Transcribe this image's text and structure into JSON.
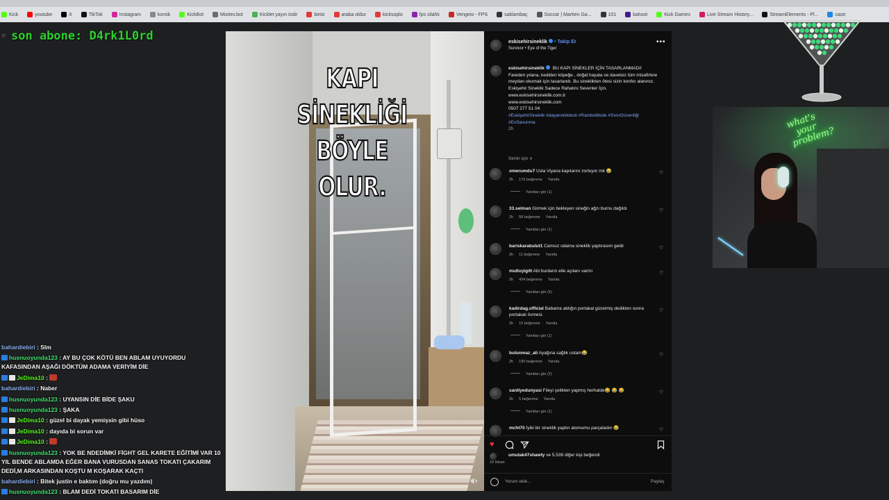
{
  "bookmarks": [
    {
      "label": "Kick",
      "color": "#53fc18"
    },
    {
      "label": "youtube",
      "color": "#ff0000"
    },
    {
      "label": "X",
      "color": "#000000"
    },
    {
      "label": "TikTok",
      "color": "#111111"
    },
    {
      "label": "Instagram",
      "color": "#d6249f"
    },
    {
      "label": "komik",
      "color": "#888888"
    },
    {
      "label": "KickBot",
      "color": "#53fc18"
    },
    {
      "label": "Mixitev.bot",
      "color": "#6b6b6b"
    },
    {
      "label": "Kicklet yayın indir",
      "color": "#4caf50"
    },
    {
      "label": "binto",
      "color": "#e53935"
    },
    {
      "label": "araba oldur",
      "color": "#e53935"
    },
    {
      "label": "kicksoplo",
      "color": "#e53935"
    },
    {
      "label": "fps silahlı",
      "color": "#8e24aa"
    },
    {
      "label": "Vengeio - FPS",
      "color": "#c62828"
    },
    {
      "label": "saklambaç",
      "color": "#333333"
    },
    {
      "label": "Soccar | Martien Ga...",
      "color": "#555555"
    },
    {
      "label": "101",
      "color": "#333333"
    },
    {
      "label": "kahoot",
      "color": "#46178f"
    },
    {
      "label": "Kick Games",
      "color": "#53fc18"
    },
    {
      "label": "Live Stream History...",
      "color": "#d81b60"
    },
    {
      "label": "StreamElements - Pl...",
      "color": "#111111"
    },
    {
      "label": "castr",
      "color": "#1e88e5"
    }
  ],
  "overlay": {
    "last_sub": "son abone: D4rk1L0rd"
  },
  "chat": [
    {
      "user": "bahardiebiri",
      "color": "#8aaef0",
      "badges": [],
      "text": ": Slm",
      "emote": false
    },
    {
      "user": "husnuoyunda123",
      "color": "#3fe06d",
      "badges": [
        "#2a7de1"
      ],
      "text": ": AY BU ÇOK KÖTÜ BEN ABLAM UYUYORDU KAFASINDAN AŞAĞI DÖKTÜM ADAMA VERİYİM DİE",
      "emote": false
    },
    {
      "user": "JeDima10",
      "color": "#53fc18",
      "badges": [
        "#2a7de1",
        "#e6e6e6"
      ],
      "text": ":",
      "emote": true
    },
    {
      "user": "bahardiebiri",
      "color": "#8aaef0",
      "badges": [],
      "text": ": Naber",
      "emote": false
    },
    {
      "user": "husnuoyunda123",
      "color": "#3fe06d",
      "badges": [
        "#2a7de1"
      ],
      "text": ": UYANSIN DİE BİDE ŞAKU",
      "emote": false
    },
    {
      "user": "husnuoyunda123",
      "color": "#3fe06d",
      "badges": [
        "#2a7de1"
      ],
      "text": ": ŞAKA",
      "emote": false
    },
    {
      "user": "JeDima10",
      "color": "#53fc18",
      "badges": [
        "#2a7de1",
        "#e6e6e6"
      ],
      "text": ": güzel bi dayak yemişsin gibi hüso",
      "emote": false
    },
    {
      "user": "JeDima10",
      "color": "#53fc18",
      "badges": [
        "#2a7de1",
        "#e6e6e6"
      ],
      "text": ": dayıda bi sorun var",
      "emote": false
    },
    {
      "user": "JeDima10",
      "color": "#53fc18",
      "badges": [
        "#2a7de1",
        "#e6e6e6"
      ],
      "text": ":",
      "emote": true
    },
    {
      "user": "husnuoyunda123",
      "color": "#3fe06d",
      "badges": [
        "#2a7de1"
      ],
      "text": ": YOK BE NDEDİMKİ FİGHT GEL KARETE EĞİTİMİ VAR 10 YIL BENDE ABLAMDA EĞER BANA VURUSDAN SANAS TOKATI ÇAKARIM DEDİ,M ARKASINDAN KOŞTU M KOŞARAK KAÇTI",
      "emote": false
    },
    {
      "user": "bahardiebiri",
      "color": "#8aaef0",
      "badges": [],
      "text": ": Bitek justin e baktım (doğru mu yazdım)",
      "emote": false
    },
    {
      "user": "husnuoyunda123",
      "color": "#3fe06d",
      "badges": [
        "#2a7de1"
      ],
      "text": ": BLAM DEDİ TOKATI BASARIM DİE",
      "emote": false
    }
  ],
  "video": {
    "overlay_line1": "KAPI SİNEKLİĞİ",
    "overlay_line2": "BÖYLE OLUR."
  },
  "post": {
    "username": "eskisehirsineklik",
    "follow_label": "• Takip Et",
    "audio": "Survivor • Eye of the Tiger",
    "more_icon": "more-horizontal-icon",
    "caption_user": "eskisehirsineklik",
    "caption_lines": [
      "BU KAPI SİNEKLER İÇİN TASARLANMADI!",
      "Fareden yılana, kediden köpeğe , doğal hayata ve davetsiz tüm misafirlere meydan okumak için tasarlandı. Bu sineklikten ötesi sizin konfor alanınız.",
      "Eskişehir Sineklik Sadece Rahatını Sevenler İçin.",
      "www.eskisehirsineklik.com.tr",
      "www.eskisehirsineklik.com",
      "0507 277 51 04"
    ],
    "hashtags": "#EskişehirSineklik #dayanıklıktesti #RamboMode #SınırGüvenliği #EvSavunma",
    "caption_time": "2h",
    "for_you": "Senin için ∨",
    "comments": [
      {
        "user": "omerumdu7",
        "text": "Usta Viyana kapılarını zorluyor mk 😂",
        "time": "2h",
        "likes": "179 beğenme",
        "reply": "Yanıtla",
        "replies": "Yanıtları gör (1)"
      },
      {
        "user": "33.selman",
        "text": "Girmek için bekleyen sineğin ağzı burnu dağıldı",
        "time": "2h",
        "likes": "58 beğenme",
        "reply": "Yanıtla",
        "replies": "Yanıtları gör (1)"
      },
      {
        "user": "bariskarabulut1",
        "text": "Camsız odama sineklik yaptırasım geldi",
        "time": "2h",
        "likes": "11 beğenme",
        "reply": "Yanıtla",
        "replies": ""
      },
      {
        "user": "mutluyigitt",
        "text": "Abi bunların elle açılanı varmı",
        "time": "2h",
        "likes": "434 beğenme",
        "reply": "Yanıtla",
        "replies": "Yanıtları gör (5)"
      },
      {
        "user": "kadirdag.official",
        "text": "Babama aldığın portakal güzelmiş dedikten sonra portakalı övmesi.",
        "time": "2h",
        "likes": "15 beğenme",
        "reply": "Yanıtla",
        "replies": "Yanıtları gör (1)"
      },
      {
        "user": "bulunmaz_ali",
        "text": "Ayağına sağlık ustam😂",
        "time": "2h",
        "likes": "190 beğenme",
        "reply": "Yanıtla",
        "replies": "Yanıtları gör (2)"
      },
      {
        "user": "santiyedunyasi",
        "text": "Fileyi çelikten yapmış herhalde😂 😂 😂",
        "time": "2h",
        "likes": "5 beğenme",
        "reply": "Yanıtla",
        "replies": "Yanıtları gör (1)"
      },
      {
        "user": "mcht70",
        "text": "İyiki bir sineklik yaptın atomumu parçaladın 😂",
        "time": "",
        "likes": "",
        "reply": "",
        "replies": ""
      }
    ],
    "likes_user": "umutak47shawty",
    "likes_rest": "ve 5.539 diğer kişi beğendi",
    "date": "10 Nisan",
    "add_comment_placeholder": "Yorum ekle...",
    "post_button": "Paylaş"
  },
  "cam": {
    "neon_line1": "what's",
    "neon_line2": "your",
    "neon_line3": "problem?"
  }
}
